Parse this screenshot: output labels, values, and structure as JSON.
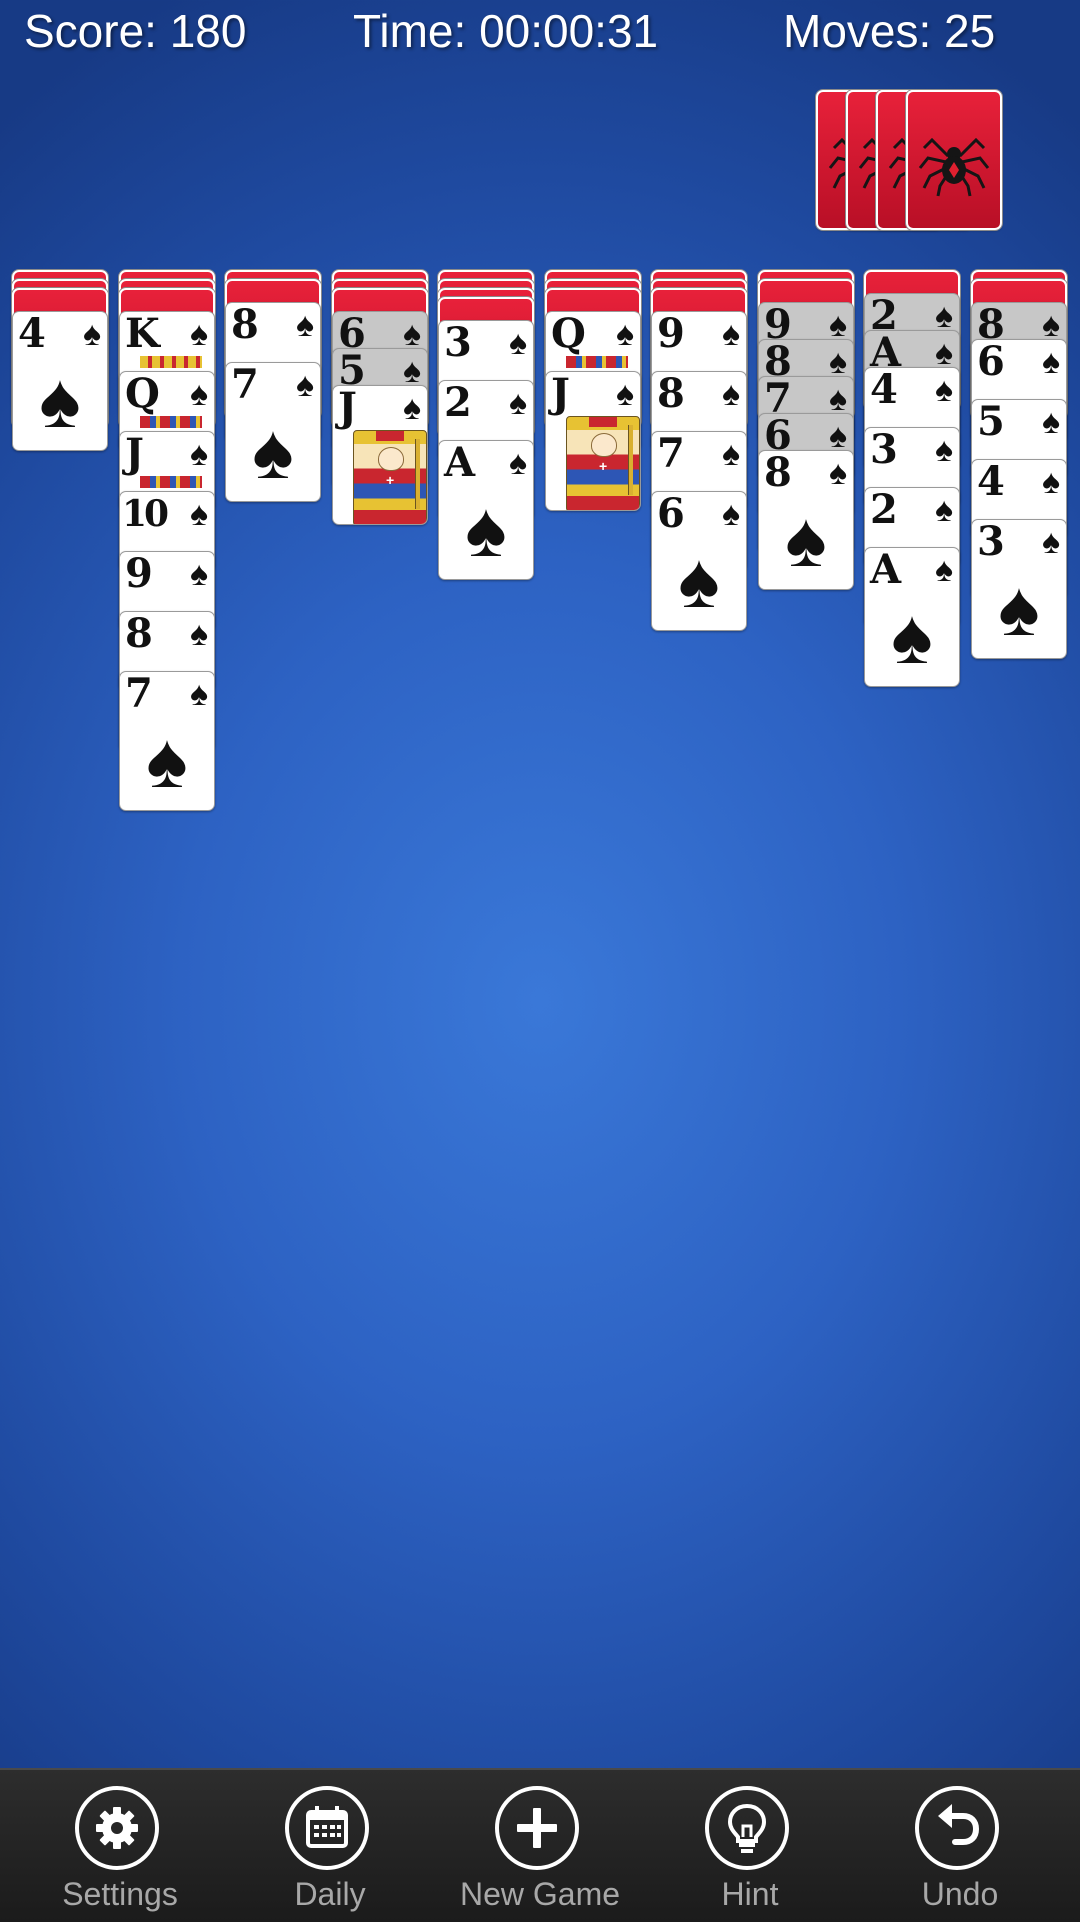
{
  "hud": {
    "score": "Score: 180",
    "time": "Time: 00:00:31",
    "moves": "Moves: 25"
  },
  "stock": {
    "remaining_deals": 4,
    "back_icon": "spider-icon"
  },
  "suit_symbol": "♠",
  "colors": {
    "card_back": "#d6172e",
    "felt": "#2d62c3",
    "toolbar": "#1f1f1f",
    "toolbar_label": "#a8a8a8"
  },
  "tableau": [
    {
      "facedown": 3,
      "cards": [
        {
          "rank": "4"
        }
      ]
    },
    {
      "facedown": 3,
      "cards": [
        {
          "rank": "K",
          "court": true
        },
        {
          "rank": "Q",
          "court": true
        },
        {
          "rank": "J",
          "court": true
        },
        {
          "rank": "10"
        },
        {
          "rank": "9"
        },
        {
          "rank": "8"
        },
        {
          "rank": "7"
        }
      ]
    },
    {
      "facedown": 2,
      "cards": [
        {
          "rank": "8"
        },
        {
          "rank": "7"
        }
      ]
    },
    {
      "facedown": 3,
      "cards": [
        {
          "rank": "6",
          "grey": true
        },
        {
          "rank": "5",
          "grey": true
        },
        {
          "rank": "J",
          "court": true
        }
      ]
    },
    {
      "facedown": 4,
      "cards": [
        {
          "rank": "3"
        },
        {
          "rank": "2"
        },
        {
          "rank": "A"
        }
      ]
    },
    {
      "facedown": 3,
      "cards": [
        {
          "rank": "Q",
          "court": true
        },
        {
          "rank": "J",
          "court": true
        }
      ]
    },
    {
      "facedown": 3,
      "cards": [
        {
          "rank": "9"
        },
        {
          "rank": "8"
        },
        {
          "rank": "7"
        },
        {
          "rank": "6"
        }
      ]
    },
    {
      "facedown": 2,
      "cards": [
        {
          "rank": "9",
          "grey": true
        },
        {
          "rank": "8",
          "grey": true
        },
        {
          "rank": "7",
          "grey": true
        },
        {
          "rank": "6",
          "grey": true
        },
        {
          "rank": "8"
        }
      ]
    },
    {
      "facedown": 1,
      "cards": [
        {
          "rank": "2",
          "grey": true
        },
        {
          "rank": "A",
          "grey": true
        },
        {
          "rank": "4"
        },
        {
          "rank": "3"
        },
        {
          "rank": "2"
        },
        {
          "rank": "A"
        }
      ]
    },
    {
      "facedown": 2,
      "cards": [
        {
          "rank": "8",
          "grey": true
        },
        {
          "rank": "6"
        },
        {
          "rank": "5"
        },
        {
          "rank": "4"
        },
        {
          "rank": "3"
        }
      ]
    }
  ],
  "toolbar": {
    "settings_label": "Settings",
    "daily_label": "Daily",
    "new_game_label": "New Game",
    "hint_label": "Hint",
    "undo_label": "Undo"
  }
}
